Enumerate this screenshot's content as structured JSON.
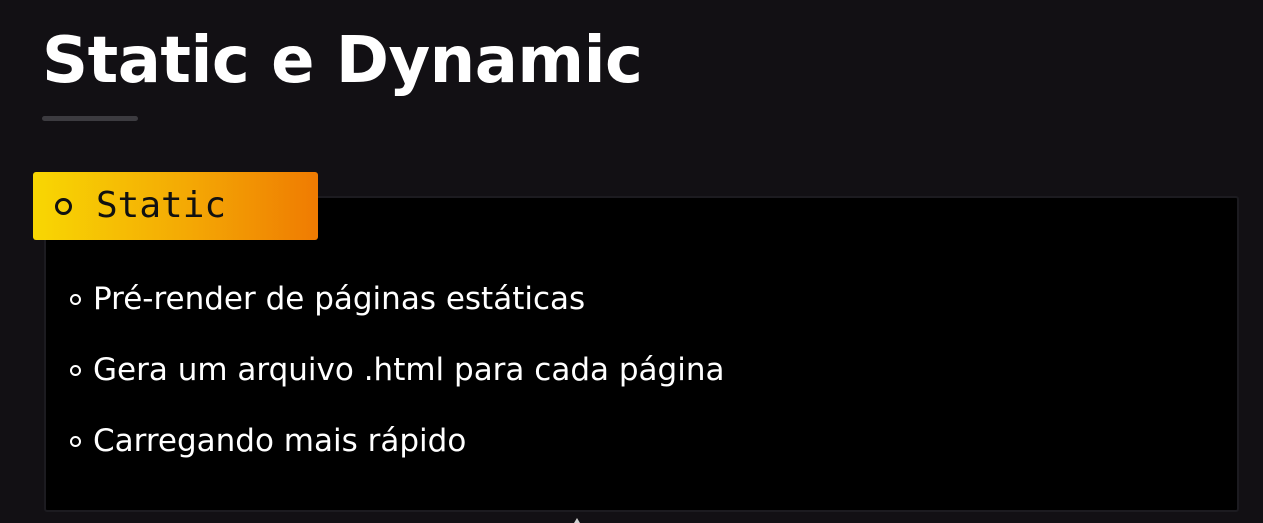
{
  "slide": {
    "title": "Static e Dynamic"
  },
  "section": {
    "badge_label": "Static",
    "badge_icon": "circle-outline-icon",
    "badge_gradient": [
      "#f8d703",
      "#ef7b02"
    ],
    "bullet_icon": "circle-bullet-icon",
    "items": [
      {
        "text": "Pré-render de páginas estáticas"
      },
      {
        "text": "Gera um arquivo .html para cada página"
      },
      {
        "text": "Carregando mais rápido"
      }
    ]
  },
  "colors": {
    "background": "#121014",
    "card": "#000000",
    "text": "#ffffff"
  }
}
